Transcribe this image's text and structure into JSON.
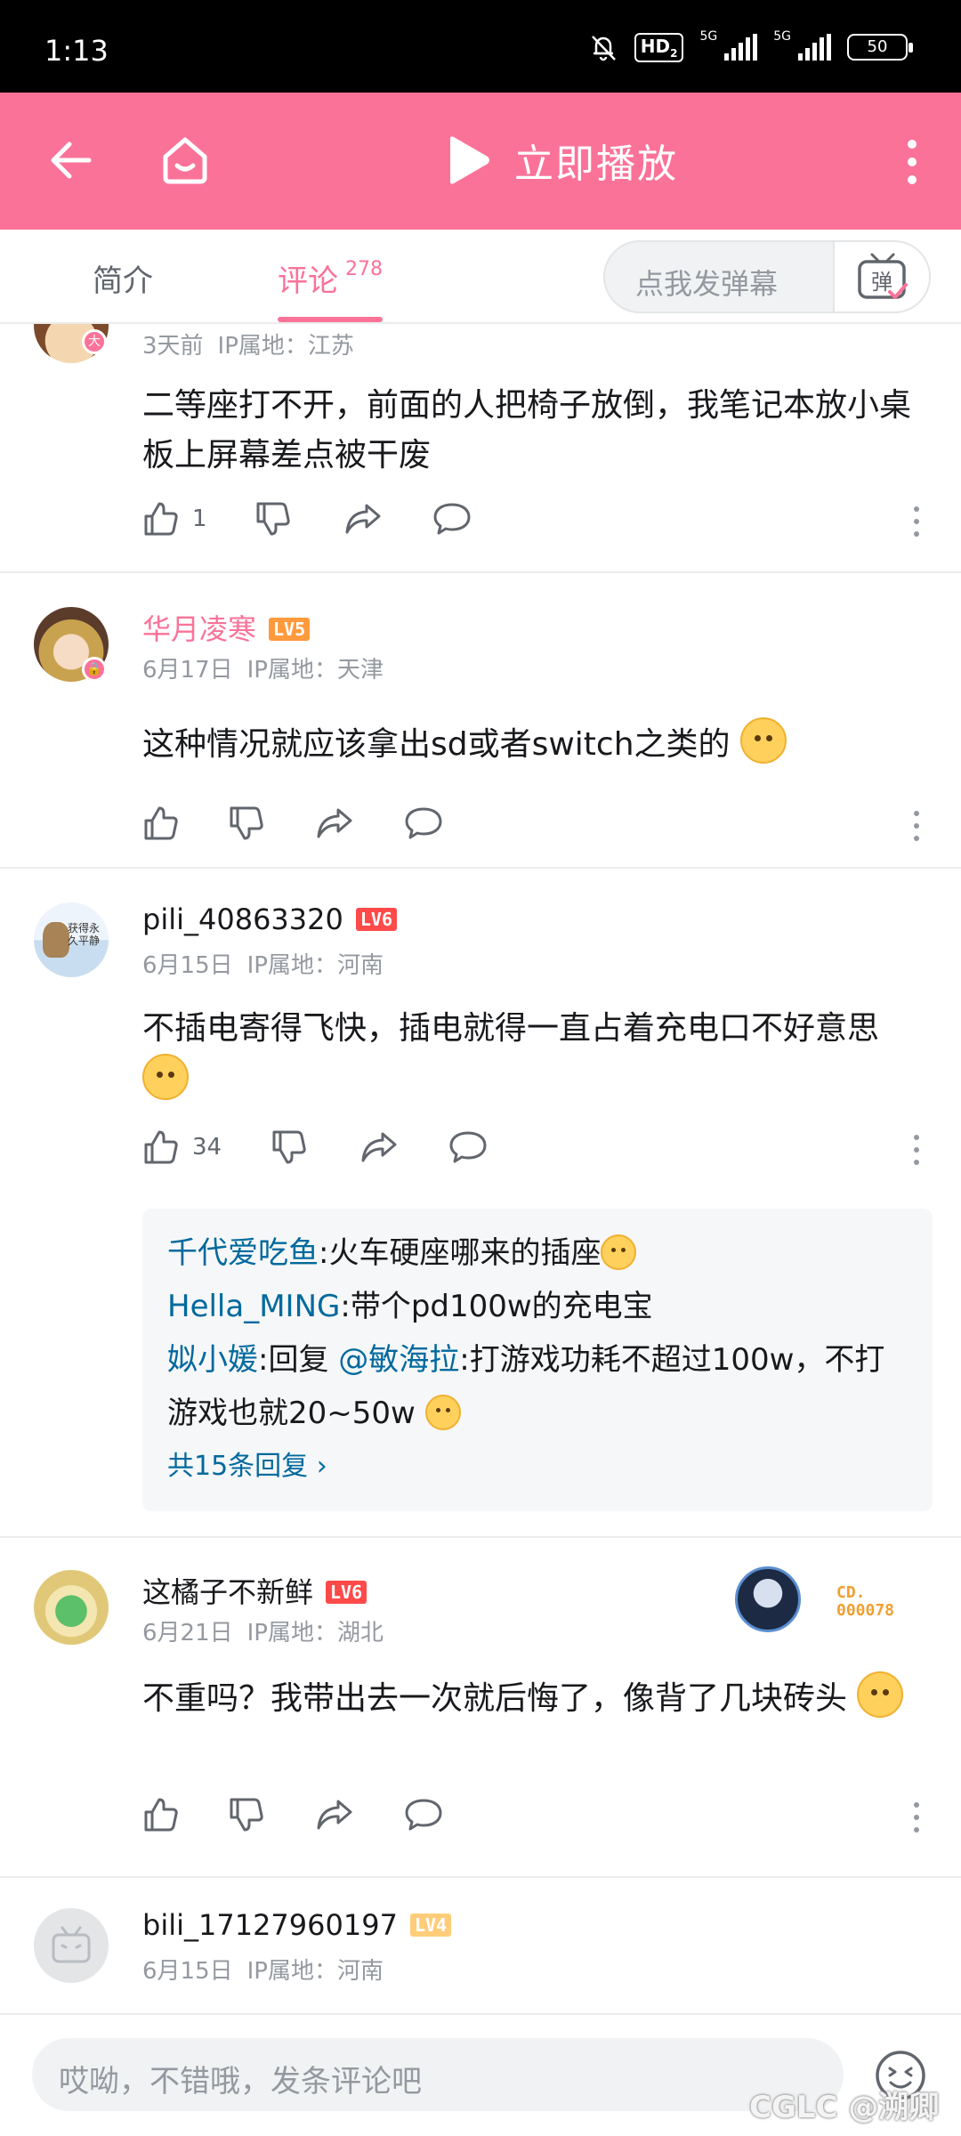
{
  "status_bar": {
    "time": "1:13",
    "hd": "HD",
    "hd_sub": "2",
    "net1": "5G",
    "net2": "5G",
    "battery": "50"
  },
  "header": {
    "play_label": "立即播放",
    "background_color": "#fb7299"
  },
  "tabs": {
    "intro_label": "简介",
    "comments_label": "评论",
    "comments_count": "278",
    "danmaku_placeholder": "点我发弹幕",
    "danmaku_button_icon": "danmaku-icon"
  },
  "comments": [
    {
      "time": "3天前",
      "location": "IP属地：江苏",
      "badge": "大",
      "text": "二等座打不开，前面的人把椅子放倒，我笔记本放小桌板上屏幕差点被干废",
      "likes": "1"
    },
    {
      "username": "华月凌寒",
      "level": "LV5",
      "time": "6月17日",
      "location": "IP属地：天津",
      "text": "这种情况就应该拿出sd或者switch之类的",
      "likes": ""
    },
    {
      "username": "pili_40863320",
      "level": "LV6",
      "time": "6月15日",
      "location": "IP属地：河南",
      "avatar_text": "获得永久平静",
      "text": "不插电寄得飞快，插电就得一直占着充电口不好意思",
      "likes": "34",
      "replies": [
        {
          "name": "千代爱吃鱼",
          "text": ":火车硬座哪来的插座"
        },
        {
          "name": "Hella_MING",
          "text": ":带个pd100w的充电宝"
        },
        {
          "name": "姒小媛",
          "text": ":回复 ",
          "mention": "@敏海拉",
          "text2": ":打游戏功耗不超过100w，不打游戏也就20~50w"
        }
      ],
      "more_replies": "共15条回复 ›"
    },
    {
      "username": "这橘子不新鲜",
      "level": "LV6",
      "time": "6月21日",
      "location": "IP属地：湖北",
      "badge_text_1": "CD.",
      "badge_text_2": "000078",
      "text": "不重吗？我带出去一次就后悔了，像背了几块砖头",
      "likes": ""
    },
    {
      "username": "bili_17127960197",
      "level": "LV4",
      "time": "6月15日",
      "location": "IP属地：河南"
    }
  ],
  "bottom": {
    "placeholder": "哎呦，不错哦，发条评论吧",
    "watermark": "CGLC @溯卿"
  }
}
